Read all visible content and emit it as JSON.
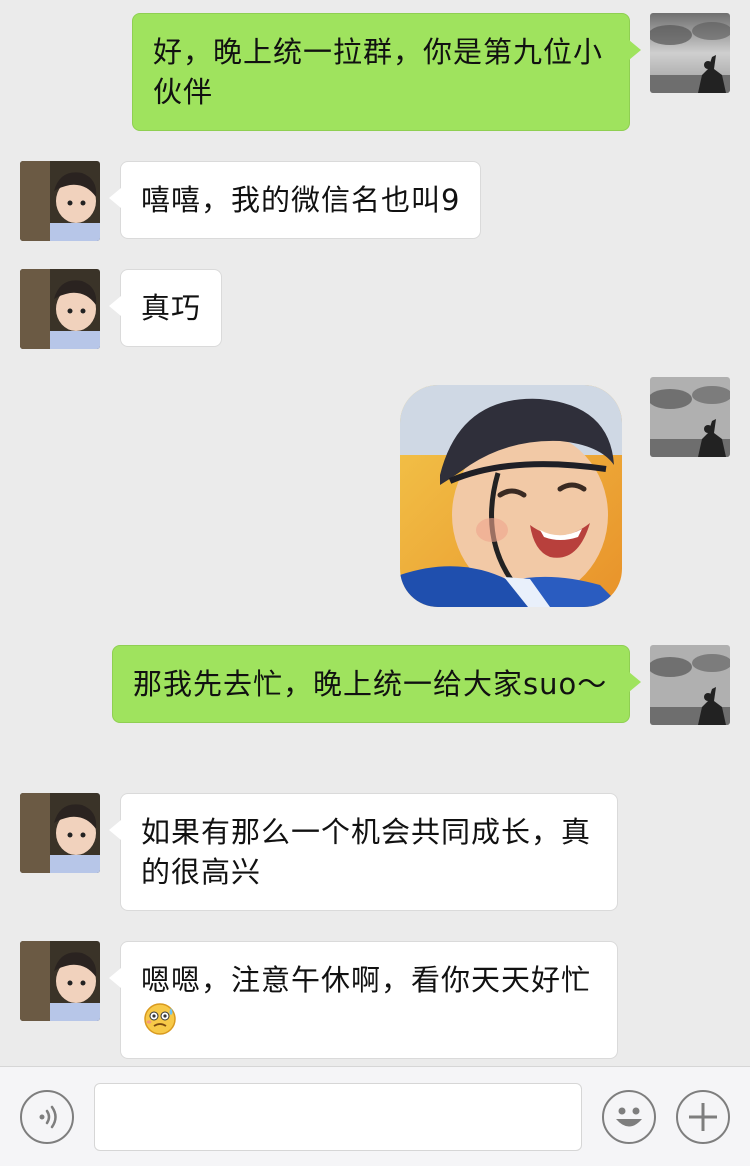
{
  "messages": [
    {
      "side": "out",
      "text": "好，晚上统一拉群，你是第九位小伙伴"
    },
    {
      "side": "in",
      "text": "嘻嘻，我的微信名也叫9"
    },
    {
      "side": "in",
      "text": "真巧"
    },
    {
      "side": "out",
      "type": "sticker",
      "icon": "baby-laughing-sticker"
    },
    {
      "side": "out",
      "text": "那我先去忙，晚上统一给大家suo～"
    },
    {
      "side": "in",
      "text": "如果有那么一个机会共同成长，真的很高兴"
    },
    {
      "side": "in",
      "text": "嗯嗯，注意午休啊，看你天天好忙",
      "emoji": "sweating-smile-emoji"
    }
  ],
  "input": {
    "value": ""
  },
  "toolbar": {
    "voice_icon": "voice-icon",
    "emoji_icon": "emoji-icon",
    "more_icon": "plus-icon"
  },
  "colors": {
    "background": "#ebebeb",
    "outgoing_bubble": "#9fe35e",
    "incoming_bubble": "#ffffff"
  }
}
